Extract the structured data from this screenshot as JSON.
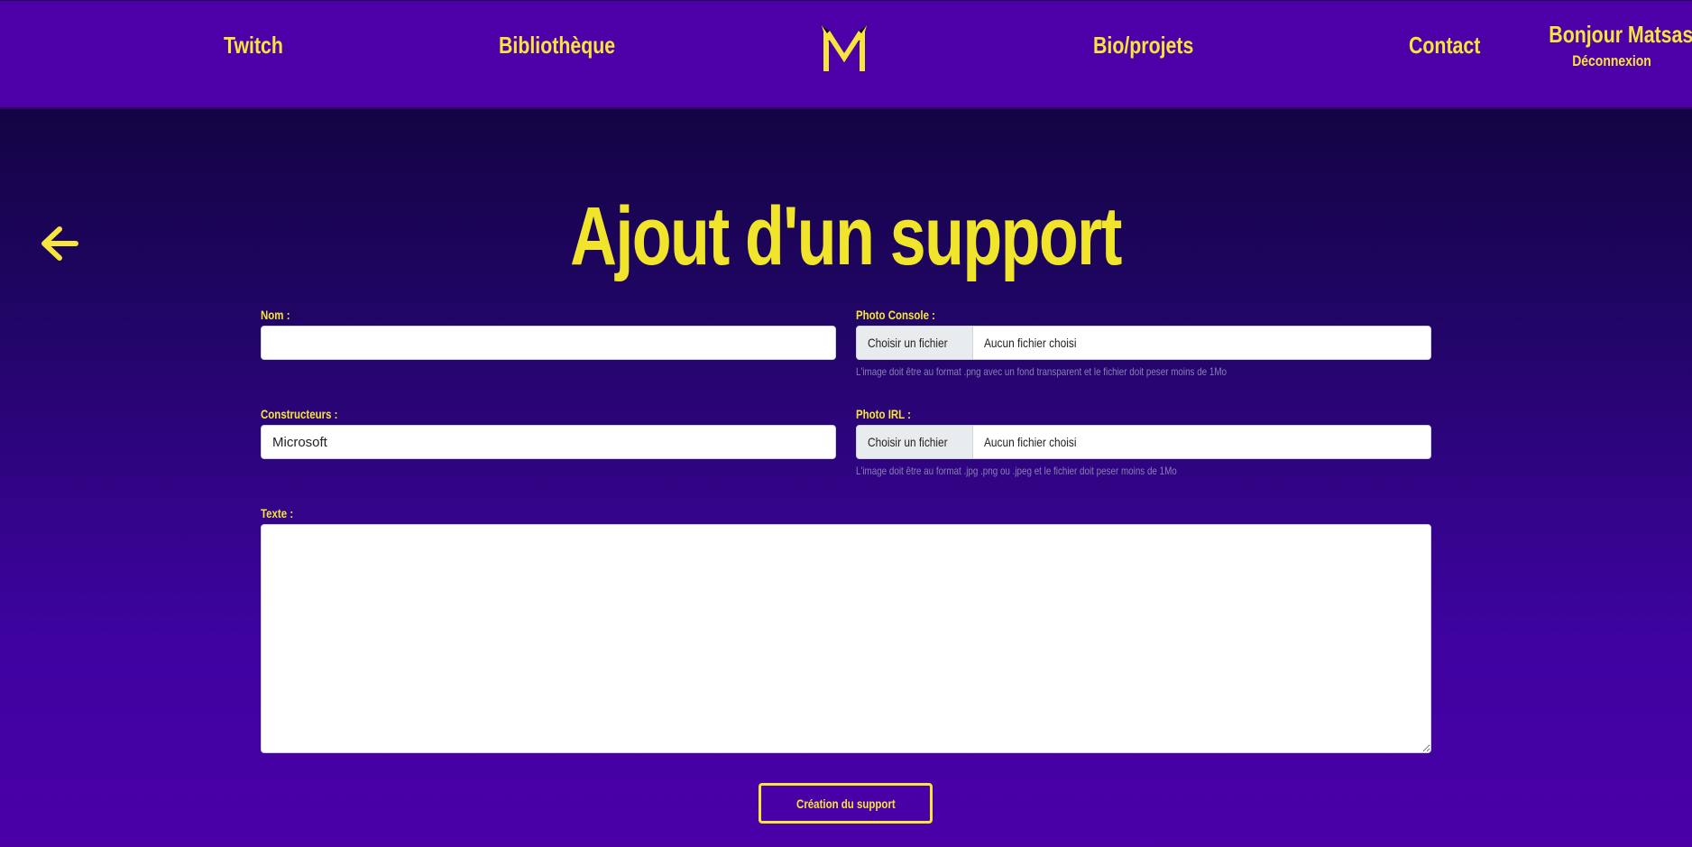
{
  "nav": {
    "twitch": "Twitch",
    "bibliotheque": "Bibliothèque",
    "bio": "Bio/projets",
    "contact": "Contact",
    "greeting": "Bonjour Matsashi",
    "logout": "Déconnexion",
    "logo_icon": "m-logo-icon"
  },
  "page": {
    "title": "Ajout d'un support",
    "back_icon": "arrow-left-icon"
  },
  "form": {
    "nom_label": "Nom :",
    "nom_value": "",
    "constructeurs_label": "Constructeurs :",
    "constructeurs_value": "Microsoft",
    "photo_console_label": "Photo Console :",
    "photo_console_button": "Choisir un fichier",
    "photo_console_file": "Aucun fichier choisi",
    "photo_console_hint": "L'image doit être au format .png avec un fond transparent et le fichier doit peser moins de 1Mo",
    "photo_irl_label": "Photo IRL :",
    "photo_irl_button": "Choisir un fichier",
    "photo_irl_file": "Aucun fichier choisi",
    "photo_irl_hint": "L'image doit être au format .jpg .png ou .jpeg et le fichier doit peser moins de 1Mo",
    "texte_label": "Texte :",
    "texte_value": "",
    "submit": "Création du support"
  },
  "colors": {
    "accent": "#f7e53b",
    "header_bg": "#4e00a8",
    "bg_top": "#0d0333",
    "bg_bottom": "#4b00a8"
  }
}
